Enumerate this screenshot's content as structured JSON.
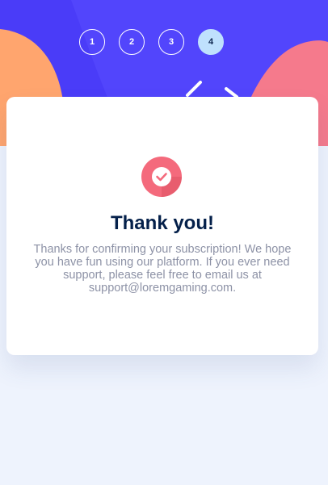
{
  "steps": [
    {
      "label": "1",
      "active": false
    },
    {
      "label": "2",
      "active": false
    },
    {
      "label": "3",
      "active": false
    },
    {
      "label": "4",
      "active": true
    }
  ],
  "card": {
    "icon": "check-badge-icon",
    "title": "Thank you!",
    "message": "Thanks for confirming your subscription! We hope you have fun using our platform. If you ever need support, please feel free to email us at support@loremgaming.com."
  },
  "colors": {
    "hero_bg": "#4a3cf8",
    "accent_orange": "#ffa56e",
    "accent_pink": "#f56c87",
    "active_step": "#bfe1fd",
    "title": "#04204a",
    "text": "#8d92a6"
  }
}
